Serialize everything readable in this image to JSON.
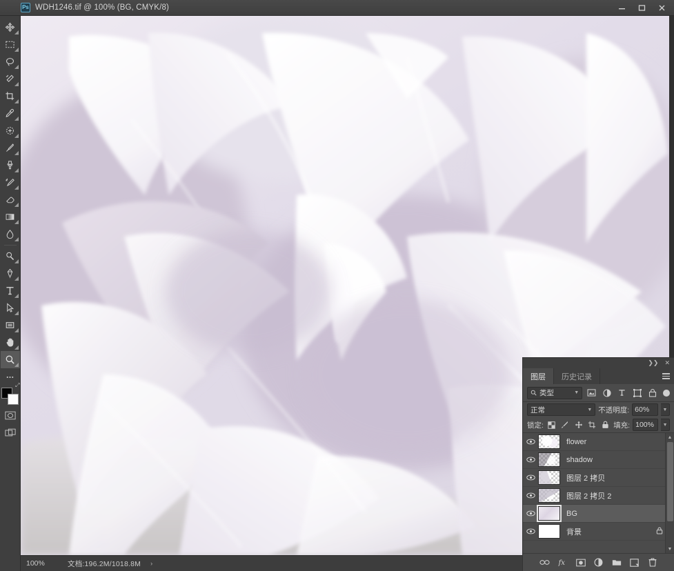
{
  "window": {
    "title": "WDH1246.tif @ 100% (BG, CMYK/8)",
    "app_badge": "Ps",
    "controls": {
      "minimize": "minimize-button",
      "maximize": "maximize-button",
      "close": "close-button"
    }
  },
  "toolbar": {
    "tools": [
      {
        "name": "move-tool",
        "icon": "move-icon"
      },
      {
        "name": "marquee-tool",
        "icon": "rectangular-marquee-icon"
      },
      {
        "name": "lasso-tool",
        "icon": "lasso-icon"
      },
      {
        "name": "quick-selection-tool",
        "icon": "magic-wand-icon"
      },
      {
        "name": "crop-tool",
        "icon": "crop-icon"
      },
      {
        "name": "eyedropper-tool",
        "icon": "eyedropper-icon"
      },
      {
        "name": "spot-healing-tool",
        "icon": "healing-brush-icon"
      },
      {
        "name": "brush-tool",
        "icon": "brush-icon"
      },
      {
        "name": "clone-stamp-tool",
        "icon": "clone-stamp-icon"
      },
      {
        "name": "history-brush-tool",
        "icon": "history-brush-icon"
      },
      {
        "name": "eraser-tool",
        "icon": "eraser-icon"
      },
      {
        "name": "gradient-tool",
        "icon": "gradient-icon"
      },
      {
        "name": "blur-tool",
        "icon": "blur-drop-icon"
      },
      {
        "name": "dodge-tool",
        "icon": "dodge-icon"
      },
      {
        "name": "pen-tool",
        "icon": "pen-icon"
      },
      {
        "name": "type-tool",
        "icon": "type-t-icon"
      },
      {
        "name": "path-selection-tool",
        "icon": "path-arrow-icon"
      },
      {
        "name": "shape-tool",
        "icon": "rectangle-shape-icon"
      },
      {
        "name": "hand-tool",
        "icon": "hand-icon"
      },
      {
        "name": "zoom-tool",
        "icon": "magnifier-icon"
      },
      {
        "name": "edit-toolbar-button",
        "icon": "ellipsis-icon"
      }
    ],
    "foreground_color": "#050505",
    "background_color": "#ffffff",
    "quick_mask": "quick-mask-icon",
    "screen_mode": "screen-mode-icon"
  },
  "status_bar": {
    "zoom": "100%",
    "doc_info": "文档:196.2M/1018.8M",
    "arrow": "›"
  },
  "layers_panel": {
    "tabs": [
      {
        "label": "图层",
        "active": true
      },
      {
        "label": "历史记录",
        "active": false
      }
    ],
    "collapse_icon": "collapse-panel-icon",
    "close_icon": "close-panel-icon",
    "menu_icon": "panel-menu-icon",
    "filter": {
      "search_icon": "search-icon",
      "kind_label": "类型",
      "icons": [
        {
          "name": "filter-pixel-icon"
        },
        {
          "name": "filter-adjustment-icon"
        },
        {
          "name": "filter-type-icon"
        },
        {
          "name": "filter-shape-icon"
        },
        {
          "name": "filter-smart-object-icon"
        }
      ],
      "toggle": "filter-toggle-switch"
    },
    "blend": {
      "mode": "正常",
      "opacity_label": "不透明度:",
      "opacity_value": "60%"
    },
    "lock": {
      "label": "锁定:",
      "icons": [
        {
          "name": "lock-transparent-pixels-icon"
        },
        {
          "name": "lock-image-pixels-icon"
        },
        {
          "name": "lock-position-icon"
        },
        {
          "name": "lock-artboard-nesting-icon"
        },
        {
          "name": "lock-all-icon"
        }
      ],
      "fill_label": "填充:",
      "fill_value": "100%"
    },
    "layers": [
      {
        "name": "flower",
        "visible": true,
        "selected": false,
        "locked": false,
        "thumb": "transparent"
      },
      {
        "name": "shadow",
        "visible": true,
        "selected": false,
        "locked": false,
        "thumb": "transparent"
      },
      {
        "name": "图层 2 拷贝",
        "visible": true,
        "selected": false,
        "locked": false,
        "thumb": "transparent"
      },
      {
        "name": "图层 2 拷贝 2",
        "visible": true,
        "selected": false,
        "locked": false,
        "thumb": "transparent"
      },
      {
        "name": "BG",
        "visible": true,
        "selected": true,
        "locked": false,
        "thumb": "image"
      },
      {
        "name": "背景",
        "visible": true,
        "selected": false,
        "locked": true,
        "thumb": "white"
      }
    ],
    "lock_glyph": "🔒",
    "bottom_buttons": [
      {
        "name": "link-layers-button",
        "icon": "link-icon"
      },
      {
        "name": "layer-style-button",
        "icon": "fx-icon"
      },
      {
        "name": "add-layer-mask-button",
        "icon": "mask-icon"
      },
      {
        "name": "new-adjustment-layer-button",
        "icon": "adjustment-circle-icon"
      },
      {
        "name": "new-group-button",
        "icon": "folder-icon"
      },
      {
        "name": "new-layer-button",
        "icon": "new-layer-icon"
      },
      {
        "name": "delete-layer-button",
        "icon": "trash-icon"
      }
    ]
  },
  "canvas": {
    "description": "close-up macro photograph of pale white and lavender flower petals",
    "base_color": "#efeaf1"
  }
}
